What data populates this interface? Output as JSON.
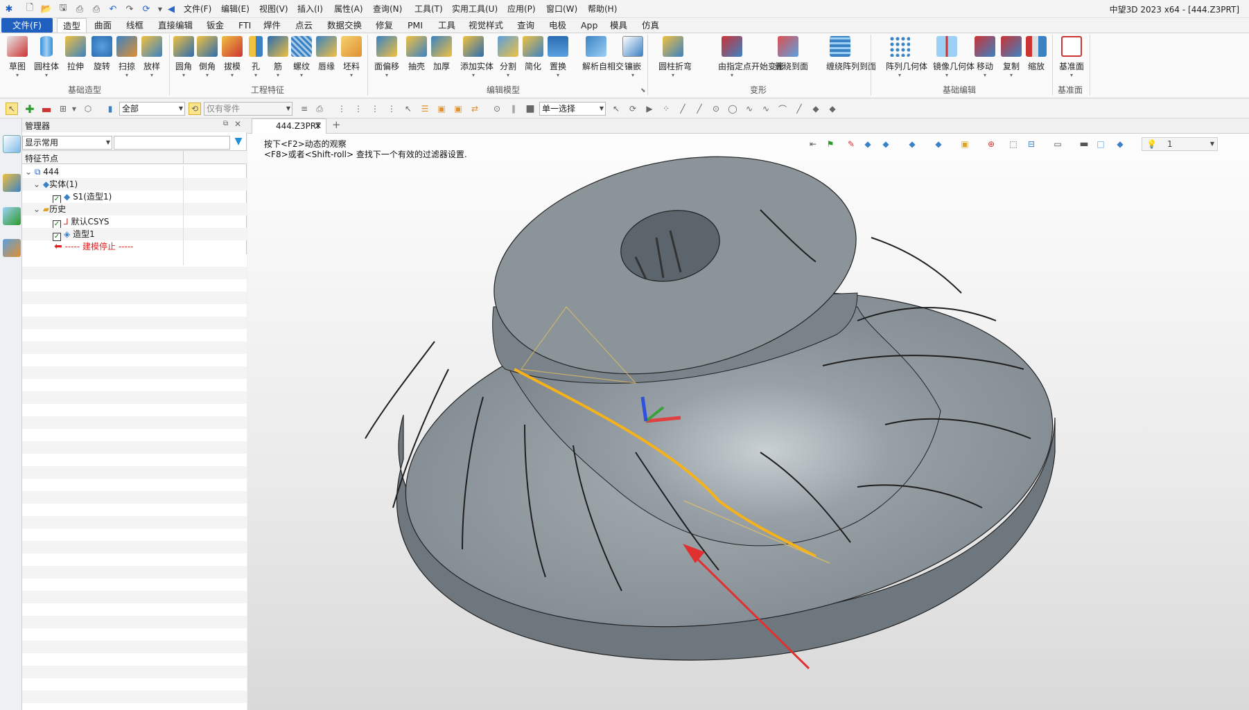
{
  "app": {
    "title": "中望3D 2023 x64 - [444.Z3PRT]"
  },
  "menubar": [
    "文件(F)",
    "编辑(E)",
    "视图(V)",
    "插入(I)",
    "属性(A)",
    "查询(N)",
    "工具(T)",
    "实用工具(U)",
    "应用(P)",
    "窗口(W)",
    "帮助(H)"
  ],
  "ribbon_tabs": [
    "文件(F)",
    "造型",
    "曲面",
    "线框",
    "直接编辑",
    "钣金",
    "FTI",
    "焊件",
    "点云",
    "数据交换",
    "修复",
    "PMI",
    "工具",
    "视觉样式",
    "查询",
    "电极",
    "App",
    "模具",
    "仿真"
  ],
  "ribbon": {
    "basic": {
      "label": "基础造型",
      "buttons": [
        "草图",
        "圆柱体",
        "拉伸",
        "旋转",
        "扫掠",
        "放样"
      ]
    },
    "engineering": {
      "label": "工程特征",
      "buttons": [
        "圆角",
        "倒角",
        "拔模",
        "孔",
        "筋",
        "螺纹",
        "唇缘",
        "坯料"
      ]
    },
    "edit": {
      "label": "编辑模型",
      "buttons": [
        "面偏移",
        "抽壳",
        "加厚",
        "添加实体",
        "分割",
        "简化",
        "置换",
        "解析自相交",
        "镶嵌"
      ]
    },
    "deform": {
      "label": "变形",
      "buttons": [
        "圆柱折弯",
        "由指定点开始变形",
        "缠绕到面",
        "缠绕阵列到面"
      ]
    },
    "basic_edit": {
      "label": "基础编辑",
      "buttons": [
        "阵列几何体",
        "镜像几何体",
        "移动",
        "复制",
        "缩放"
      ]
    },
    "datum": {
      "label": "基准面",
      "buttons": [
        "基准面"
      ]
    }
  },
  "toolbar2": {
    "filter": "全部",
    "parts_filter": "仅有零件",
    "select_mode": "单一选择"
  },
  "manager": {
    "title": "管理器",
    "display": "显示常用",
    "column": "特征节点",
    "tree": [
      {
        "label": "444",
        "level": 0,
        "check": false
      },
      {
        "label": "实体(1)",
        "level": 1,
        "check": false
      },
      {
        "label": "S1(造型1)",
        "level": 2,
        "check": true
      },
      {
        "label": "历史",
        "level": 1,
        "check": false
      },
      {
        "label": "默认CSYS",
        "level": 2,
        "check": true
      },
      {
        "label": "造型1",
        "level": 2,
        "check": true
      },
      {
        "label": "----- 建模停止 -----",
        "level": 2,
        "check": false
      }
    ]
  },
  "document": {
    "tab": "444.Z3PRT",
    "add": "+"
  },
  "viewport": {
    "hint1": "按下<F2>动态的观察",
    "hint2": "<F8>或者<Shift-roll> 查找下一个有效的过滤器设置.",
    "layer": "1"
  },
  "colors": {
    "accent": "#1f5fbf",
    "model": "#8c959b",
    "highlight": "#f5b21b",
    "arrow": "#e03030"
  }
}
